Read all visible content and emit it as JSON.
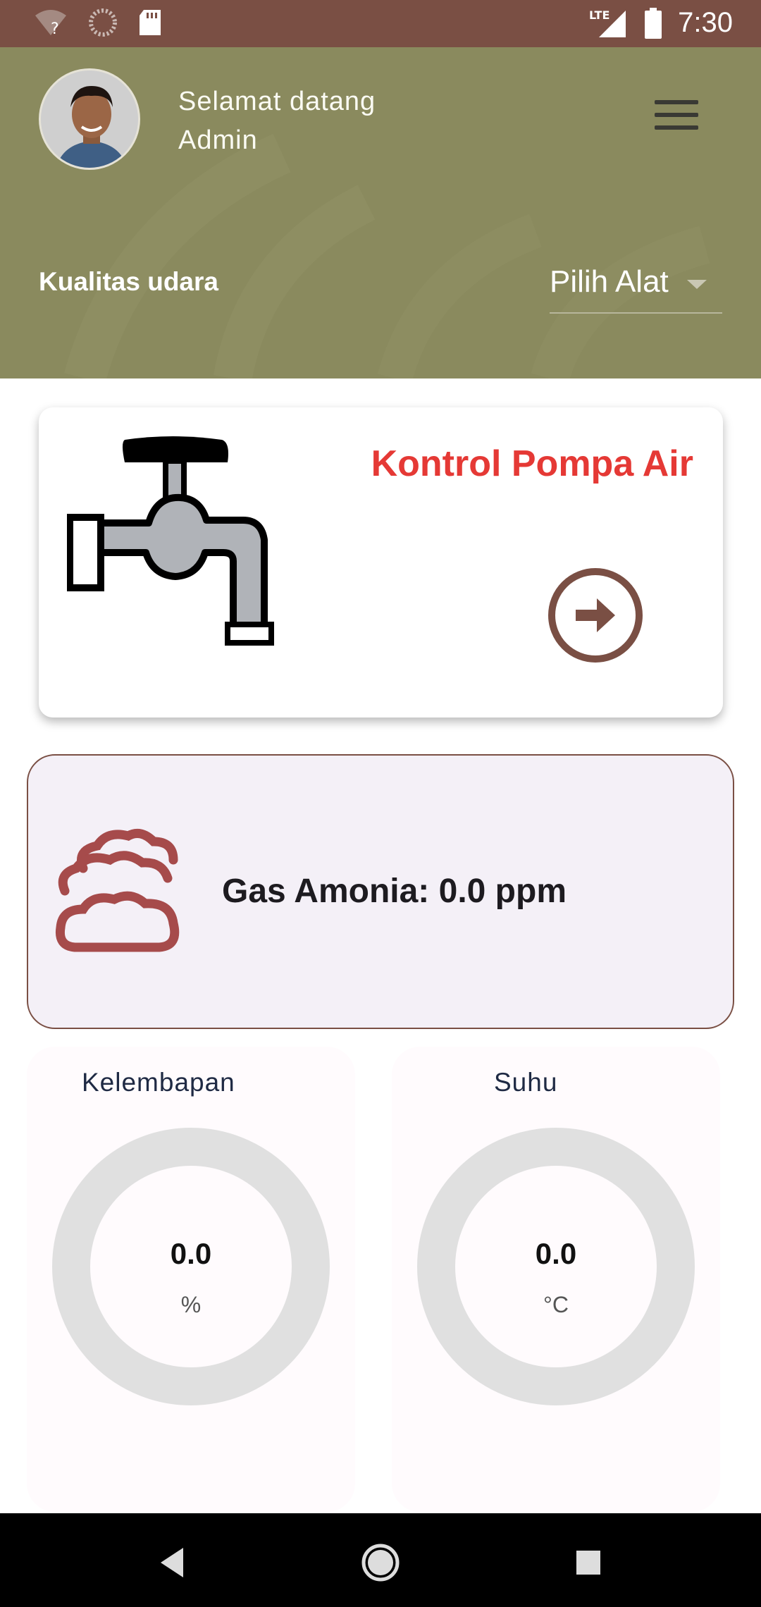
{
  "status_bar": {
    "time": "7:30",
    "icons": [
      "wifi-question-icon",
      "loading-icon",
      "sd-card-icon",
      "lte-signal-icon",
      "battery-icon"
    ],
    "network_label": "LTE"
  },
  "header": {
    "welcome_line1": "Selamat datang",
    "welcome_line2": "Admin",
    "section_title": "Kualitas udara",
    "device_select": {
      "value": "Pilih Alat"
    }
  },
  "pump_card": {
    "title": "Kontrol Pompa Air",
    "icon": "faucet-icon",
    "action_icon": "arrow-circle-right-icon"
  },
  "gas_card": {
    "icon": "clouds-icon",
    "text": "Gas Amonia: 0.0 ppm"
  },
  "gauges": [
    {
      "label": "Kelembapan",
      "value": "0.0",
      "unit": "%",
      "level": 0
    },
    {
      "label": "Suhu",
      "value": "0.0",
      "unit": "°C",
      "level": 0
    }
  ],
  "colors": {
    "status_bar": "#7a4f44",
    "header": "#8a8a5e",
    "accent_red": "#e53935",
    "brown": "#7a4f44",
    "gauge_track": "#e0e0e0"
  },
  "nav": {
    "icons": [
      "back-icon",
      "home-icon",
      "recents-icon"
    ]
  }
}
